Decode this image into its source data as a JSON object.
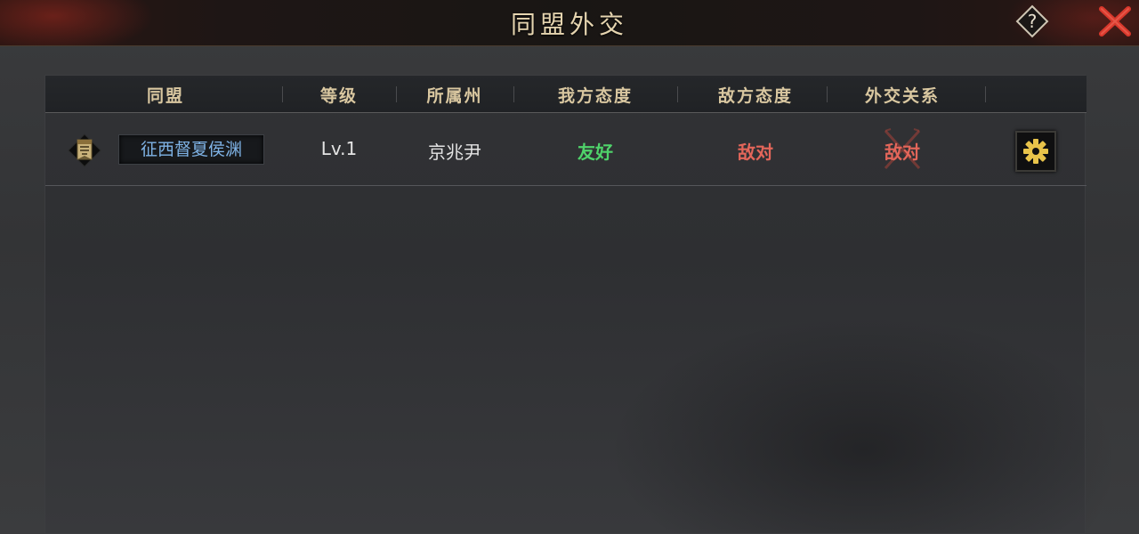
{
  "window": {
    "title": "同盟外交",
    "help_icon": "question-mark-icon",
    "close_icon": "close-x-icon"
  },
  "table": {
    "headers": [
      "同盟",
      "等级",
      "所属州",
      "我方态度",
      "敌方态度",
      "外交关系"
    ],
    "rows": [
      {
        "emblem_icon": "alliance-banner-icon",
        "alliance": "征西督夏侯渊",
        "level": "Lv.1",
        "state": "京兆尹",
        "our_attitude": "友好",
        "enemy_attitude": "敌对",
        "relation": "敌对",
        "action_icon": "gear-icon"
      }
    ]
  },
  "colors": {
    "title_gold": "#e6d5b0",
    "friendly": "#4fd36a",
    "hostile": "#e3665a",
    "alliance_name": "#7fb3e6",
    "close_red": "#d9382c"
  }
}
